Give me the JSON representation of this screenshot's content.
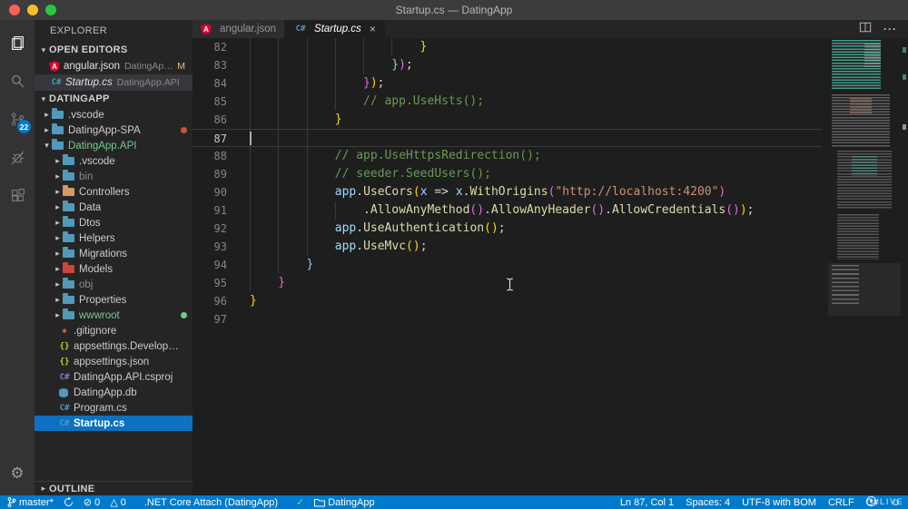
{
  "window": {
    "title": "Startup.cs — DatingApp"
  },
  "colors": {
    "titlebar": "#3C3C3C",
    "activitybar": "#333333",
    "sidebar": "#252526",
    "editor": "#1E1E1E",
    "statusbar": "#007ACC",
    "tab-inactive": "#2D2D2D",
    "selection": "#0E70C0",
    "list-active": "#37373D",
    "badge": "#007ACC",
    "comment": "#6A9955",
    "variable": "#9CDCFE",
    "method": "#DCDCAA",
    "punct": "#D4D4D4",
    "string": "#CE9178",
    "bracket-gold": "#FFD700",
    "bracket-orchid": "#DA70D6",
    "bracket-blue": "#87CEFA",
    "git-added": "#73C991",
    "git-modified": "#E2C08D"
  },
  "activity_bar": {
    "items": [
      {
        "name": "explorer",
        "active": true
      },
      {
        "name": "search"
      },
      {
        "name": "source-control",
        "badge": "22"
      },
      {
        "name": "debug"
      },
      {
        "name": "extensions"
      }
    ]
  },
  "sidebar": {
    "title": "EXPLORER",
    "open_editors": {
      "header": "OPEN EDITORS",
      "items": [
        {
          "label": "angular.json",
          "detail": "DatingApp...",
          "icon": "angular",
          "badge": "M"
        },
        {
          "label": "Startup.cs",
          "detail": "DatingApp.API",
          "icon": "csharp",
          "active": true,
          "italic": true
        }
      ]
    },
    "project": {
      "header": "DATINGAPP",
      "tree": [
        {
          "label": ".vscode",
          "type": "folder",
          "chevron": "collapsed",
          "depth": 0
        },
        {
          "label": "DatingApp-SPA",
          "type": "folder",
          "chevron": "collapsed",
          "depth": 0,
          "dot": "#C7563E"
        },
        {
          "label": "DatingApp.API",
          "type": "folder",
          "chevron": "expanded",
          "depth": 0,
          "color": "added"
        },
        {
          "label": ".vscode",
          "type": "folder",
          "chevron": "collapsed",
          "depth": 1
        },
        {
          "label": "bin",
          "type": "folder",
          "chevron": "collapsed",
          "depth": 1,
          "color": "dim"
        },
        {
          "label": "Controllers",
          "type": "folder-orange",
          "chevron": "collapsed",
          "depth": 1
        },
        {
          "label": "Data",
          "type": "folder",
          "chevron": "collapsed",
          "depth": 1
        },
        {
          "label": "Dtos",
          "type": "folder",
          "chevron": "collapsed",
          "depth": 1
        },
        {
          "label": "Helpers",
          "type": "folder",
          "chevron": "collapsed",
          "depth": 1
        },
        {
          "label": "Migrations",
          "type": "folder",
          "chevron": "collapsed",
          "depth": 1
        },
        {
          "label": "Models",
          "type": "folder-red",
          "chevron": "collapsed",
          "depth": 1
        },
        {
          "label": "obj",
          "type": "folder",
          "chevron": "collapsed",
          "depth": 1,
          "color": "dim"
        },
        {
          "label": "Properties",
          "type": "folder",
          "chevron": "collapsed",
          "depth": 1
        },
        {
          "label": "wwwroot",
          "type": "folder",
          "chevron": "collapsed",
          "depth": 1,
          "color": "added",
          "dot": "#73C991"
        },
        {
          "label": ".gitignore",
          "type": "git",
          "depth": 1
        },
        {
          "label": "appsettings.Developme...",
          "type": "json",
          "depth": 1
        },
        {
          "label": "appsettings.json",
          "type": "json",
          "depth": 1
        },
        {
          "label": "DatingApp.API.csproj",
          "type": "csproj",
          "depth": 1
        },
        {
          "label": "DatingApp.db",
          "type": "db",
          "depth": 1
        },
        {
          "label": "Program.cs",
          "type": "csharp",
          "depth": 1
        },
        {
          "label": "Startup.cs",
          "type": "csharp",
          "depth": 1,
          "selected": true
        }
      ]
    },
    "outline": {
      "header": "OUTLINE"
    }
  },
  "tabs": [
    {
      "label": "angular.json",
      "icon": "angular"
    },
    {
      "label": "Startup.cs",
      "icon": "csharp",
      "active": true,
      "italic": true,
      "close": "×"
    }
  ],
  "tab_actions": {
    "more_glyph": "···"
  },
  "code": {
    "cursor_line": 87,
    "lines": [
      {
        "n": 82,
        "indent": 24,
        "seg": [
          [
            "}",
            "b1"
          ]
        ]
      },
      {
        "n": 83,
        "indent": 20,
        "seg": [
          [
            "}",
            "b3"
          ],
          [
            ")",
            "b2"
          ],
          [
            ";",
            "pun"
          ]
        ]
      },
      {
        "n": 84,
        "indent": 16,
        "seg": [
          [
            "}",
            "b2"
          ],
          [
            ")",
            "b1"
          ],
          [
            ";",
            "pun"
          ]
        ]
      },
      {
        "n": 85,
        "indent": 16,
        "seg": [
          [
            "// app.UseHsts();",
            "cm"
          ]
        ]
      },
      {
        "n": 86,
        "indent": 12,
        "seg": [
          [
            "}",
            "b1"
          ]
        ]
      },
      {
        "n": 87,
        "indent": 0,
        "g": 12,
        "seg": []
      },
      {
        "n": 88,
        "indent": 12,
        "seg": [
          [
            "// app.UseHttpsRedirection();",
            "cm"
          ]
        ]
      },
      {
        "n": 89,
        "indent": 12,
        "seg": [
          [
            "// seeder.SeedUsers();",
            "cm"
          ]
        ]
      },
      {
        "n": 90,
        "indent": 12,
        "seg": [
          [
            "app",
            "var"
          ],
          [
            ".",
            "pun"
          ],
          [
            "UseCors",
            "meth"
          ],
          [
            "(",
            "b1"
          ],
          [
            "x",
            "var"
          ],
          [
            " => ",
            "pun"
          ],
          [
            "x",
            "var"
          ],
          [
            ".",
            "pun"
          ],
          [
            "WithOrigins",
            "meth"
          ],
          [
            "(",
            "b2"
          ],
          [
            "\"http://localhost:4200\"",
            "str"
          ],
          [
            ")",
            "b2"
          ]
        ]
      },
      {
        "n": 91,
        "indent": 16,
        "seg": [
          [
            ".",
            "pun"
          ],
          [
            "AllowAnyMethod",
            "meth"
          ],
          [
            "()",
            "b2"
          ],
          [
            ".",
            "pun"
          ],
          [
            "AllowAnyHeader",
            "meth"
          ],
          [
            "()",
            "b2"
          ],
          [
            ".",
            "pun"
          ],
          [
            "AllowCredentials",
            "meth"
          ],
          [
            "()",
            "b2"
          ],
          [
            ")",
            "b1"
          ],
          [
            ";",
            "pun"
          ]
        ]
      },
      {
        "n": 92,
        "indent": 12,
        "seg": [
          [
            "app",
            "var"
          ],
          [
            ".",
            "pun"
          ],
          [
            "UseAuthentication",
            "meth"
          ],
          [
            "()",
            "b1"
          ],
          [
            ";",
            "pun"
          ]
        ]
      },
      {
        "n": 93,
        "indent": 12,
        "seg": [
          [
            "app",
            "var"
          ],
          [
            ".",
            "pun"
          ],
          [
            "UseMvc",
            "meth"
          ],
          [
            "()",
            "b1"
          ],
          [
            ";",
            "pun"
          ]
        ]
      },
      {
        "n": 94,
        "indent": 8,
        "seg": [
          [
            "}",
            "b3"
          ]
        ]
      },
      {
        "n": 95,
        "indent": 4,
        "seg": [
          [
            "}",
            "b2"
          ]
        ]
      },
      {
        "n": 96,
        "indent": 0,
        "seg": [
          [
            "}",
            "b1"
          ]
        ]
      },
      {
        "n": 97,
        "indent": 0,
        "g": 0,
        "seg": []
      }
    ]
  },
  "status_bar": {
    "left": [
      {
        "name": "git-branch",
        "icon": "branch",
        "label": "master*"
      },
      {
        "name": "sync",
        "icon": "sync",
        "label": ""
      },
      {
        "name": "problems-errors",
        "icon": "error",
        "label": "0"
      },
      {
        "name": "problems-warnings",
        "icon": "warning",
        "label": "0"
      },
      {
        "name": "debug-configuration",
        "label": ".NET Core Attach (DatingApp)",
        "gap": true
      },
      {
        "name": "task-status",
        "icon": "check",
        "label": "",
        "color": "#89D185",
        "gap": true
      },
      {
        "name": "workspace-folder",
        "icon": "folder",
        "label": "DatingApp"
      }
    ],
    "right": [
      {
        "name": "cursor-position",
        "label": "Ln 87, Col 1"
      },
      {
        "name": "indentation",
        "label": "Spaces: 4"
      },
      {
        "name": "encoding",
        "label": "UTF-8 with BOM"
      },
      {
        "name": "eol",
        "label": "CRLF"
      },
      {
        "name": "language-mode",
        "label": "C#"
      },
      {
        "name": "feedback",
        "icon": "smiley",
        "label": ""
      }
    ]
  },
  "watermark": {
    "label": "LIVE"
  }
}
